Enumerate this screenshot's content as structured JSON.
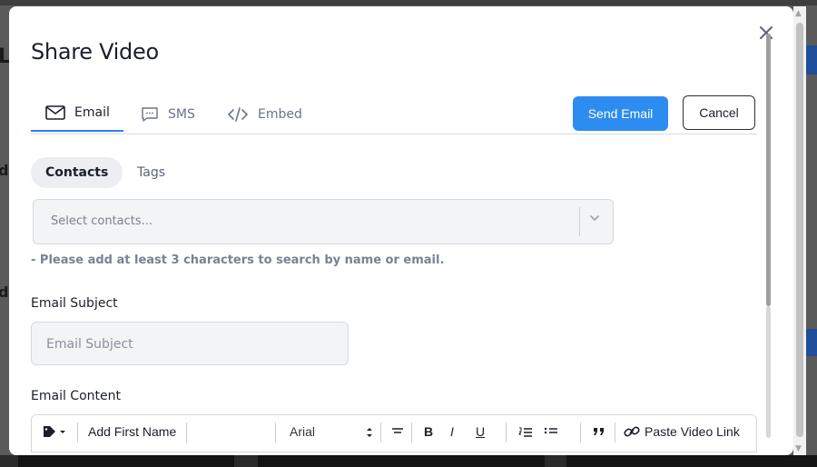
{
  "modal": {
    "title": "Share Video",
    "close_icon": "close-icon",
    "tabs": [
      {
        "label": "Email",
        "icon": "mail-icon",
        "active": true
      },
      {
        "label": "SMS",
        "icon": "chat-icon",
        "active": false
      },
      {
        "label": "Embed",
        "icon": "code-icon",
        "active": false
      }
    ],
    "send_label": "Send Email",
    "cancel_label": "Cancel",
    "recipient_tabs": [
      {
        "label": "Contacts",
        "active": true
      },
      {
        "label": "Tags",
        "active": false
      }
    ],
    "contacts_placeholder": "Select contacts...",
    "hint": "- Please add at least 3 characters to search by name or email.",
    "subject_label": "Email Subject",
    "subject_placeholder": "Email Subject",
    "content_label": "Email Content",
    "toolbar": {
      "tag_icon": "tag-icon",
      "merge_field": "Add First Name",
      "font": "Arial",
      "align_icon": "align-icon",
      "bold": "B",
      "italic": "I",
      "underline": "U",
      "ordered_list_icon": "ordered-list-icon",
      "bullet_list_icon": "bullet-list-icon",
      "quote_icon": "quote-icon",
      "paste_link_icon": "link-icon",
      "paste_link_label": "Paste Video Link"
    }
  },
  "colors": {
    "primary": "#2d8cf0",
    "overlay": "#4d4d4d",
    "tab_underline": "#2f80ed"
  }
}
